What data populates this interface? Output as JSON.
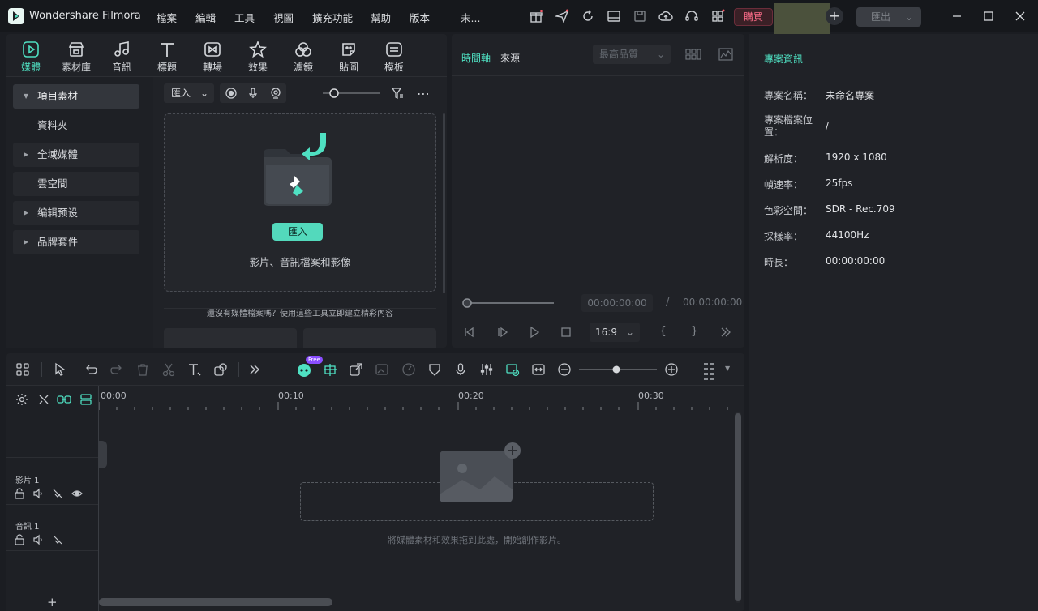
{
  "app": {
    "name": "Wondershare Filmora"
  },
  "menu": [
    "檔案",
    "編輯",
    "工具",
    "視圖",
    "擴充功能",
    "幫助",
    "版本",
    "未..."
  ],
  "titlebar": {
    "buy_label": "購買",
    "export_label": "匯出",
    "add_label": "+"
  },
  "media_tabs": [
    {
      "label": "媒體",
      "icon": "media-icon"
    },
    {
      "label": "素材庫",
      "icon": "store-icon"
    },
    {
      "label": "音訊",
      "icon": "music-icon"
    },
    {
      "label": "標題",
      "icon": "title-icon"
    },
    {
      "label": "轉場",
      "icon": "transition-icon"
    },
    {
      "label": "效果",
      "icon": "effects-icon"
    },
    {
      "label": "濾鏡",
      "icon": "filters-icon"
    },
    {
      "label": "貼圖",
      "icon": "stickers-icon"
    },
    {
      "label": "模板",
      "icon": "templates-icon"
    }
  ],
  "sidebar": {
    "items": [
      {
        "label": "項目素材"
      },
      {
        "label": "資料夾"
      },
      {
        "label": "全域媒體"
      },
      {
        "label": "雲空間"
      },
      {
        "label": "编辑预设"
      },
      {
        "label": "品牌套件"
      }
    ]
  },
  "media_toolbar": {
    "import_select": "匯入",
    "more": "⋯"
  },
  "import_area": {
    "button_label": "匯入",
    "caption": "影片、音訊檔案和影像",
    "hint": "還沒有媒體檔案嗎？使用這些工具立即建立精彩內容"
  },
  "preview": {
    "tab_timeline": "時間軸",
    "tab_source": "來源",
    "quality": "最高品質",
    "current_time": "00:00:00:00",
    "separator": "/",
    "total_time": "00:00:00:00",
    "ratio": "16:9",
    "mark_in": "{",
    "mark_out": "}"
  },
  "info": {
    "title": "專案資訊",
    "rows": [
      {
        "label": "專案名稱：",
        "value": "未命名專案"
      },
      {
        "label": "專案檔案位置：",
        "value": "/"
      },
      {
        "label": "解析度：",
        "value": "1920 x 1080"
      },
      {
        "label": "幀速率：",
        "value": "25fps"
      },
      {
        "label": "色彩空間：",
        "value": "SDR - Rec.709"
      },
      {
        "label": "採樣率：",
        "value": "44100Hz"
      },
      {
        "label": "時長：",
        "value": "00:00:00:00"
      }
    ]
  },
  "timeline": {
    "ruler": [
      "00:00",
      "00:10",
      "00:20",
      "00:30"
    ],
    "badge": "Free",
    "tracks": [
      {
        "label": "影片 1"
      },
      {
        "label": "音訊 1"
      }
    ],
    "empty_hint": "將媒體素材和效果拖到此處，開始創作影片。",
    "add_track": "+"
  },
  "colors": {
    "accent": "#4fe0c2",
    "buy": "#ff6d8a",
    "background": "#1b1d22"
  }
}
